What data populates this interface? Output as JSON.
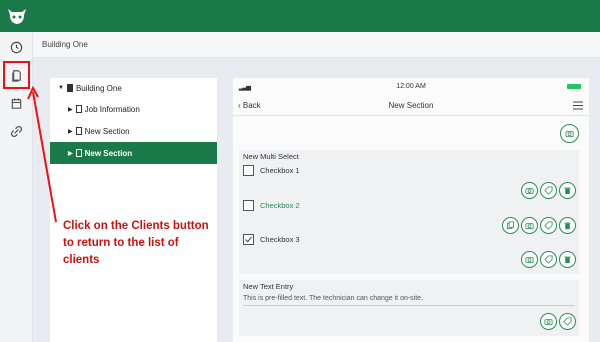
{
  "header": {
    "brand_color": "#1a7a4a",
    "logo_icon": "bull-head-logo-icon"
  },
  "left_rail": {
    "icons": [
      "clock-icon",
      "clients-doc-icon",
      "calendar-icon",
      "link-icon"
    ]
  },
  "breadcrumb": "Building One",
  "tree": {
    "items": [
      {
        "label": "Building One",
        "level": 0
      },
      {
        "label": "Job Information",
        "level": 1
      },
      {
        "label": "New Section",
        "level": 1
      },
      {
        "label": "New Section",
        "level": 1,
        "active": true
      }
    ]
  },
  "phone": {
    "time": "12:00 AM",
    "back_label": "Back",
    "nav_title": "New Section",
    "multi_select": {
      "title": "New Multi Select",
      "options": [
        {
          "label": "Checkbox 1",
          "checked": false
        },
        {
          "label": "Checkbox 2",
          "checked": false
        },
        {
          "label": "Checkbox 3",
          "checked": true
        }
      ]
    },
    "text_entry": {
      "title": "New Text Entry",
      "value": "This is pre-filled text. The technician can change it on-site."
    }
  },
  "annotation": {
    "text": "Click on the Clients button to return to the list of clients",
    "color": "#cc1111"
  }
}
